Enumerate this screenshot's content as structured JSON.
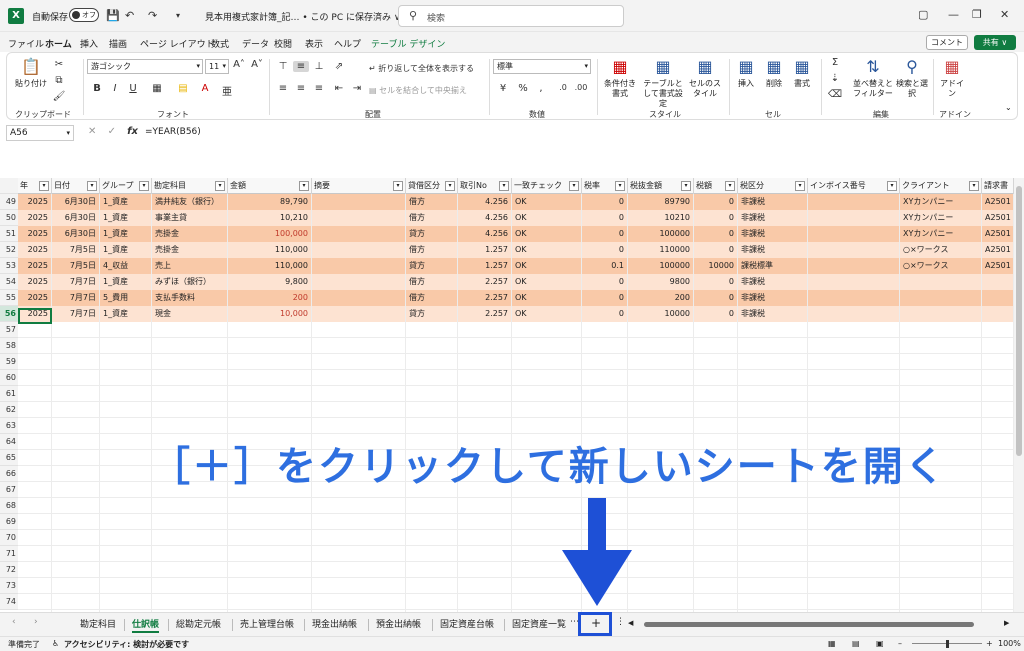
{
  "titlebar": {
    "app_icon": "excel-icon",
    "autosave_label": "自動保存",
    "autosave_state": "オフ",
    "doc_title": "見本用複式家計簿_記… • この PC に保存済み ∨",
    "search_placeholder": "検索"
  },
  "menu": {
    "tabs": [
      "ファイル",
      "ホーム",
      "挿入",
      "描画",
      "ページ レイアウト",
      "数式",
      "データ",
      "校閲",
      "表示",
      "ヘルプ",
      "テーブル デザイン"
    ],
    "comment": "コメント",
    "share": "共有 ∨"
  },
  "ribbon": {
    "paste": "貼り付け",
    "clipboard": "クリップボード",
    "font_name": "游ゴシック",
    "font_size": "11",
    "font_group": "フォント",
    "wrap_text": "折り返して全体を表示する",
    "merge_center": "セルを結合して中央揃え",
    "align_group": "配置",
    "number_format": "標準",
    "number_group": "数値",
    "cond_format": "条件付き書式",
    "table_format": "テーブルとして書式設定",
    "cell_style": "セルのスタイル",
    "style_group": "スタイル",
    "insert": "挿入",
    "delete": "削除",
    "format": "書式",
    "cells_group": "セル",
    "sort_filter": "並べ替えとフィルター",
    "find_select": "検索と選択",
    "edit_group": "編集",
    "addin": "アドイン",
    "addin_group": "アドイン"
  },
  "formula_bar": {
    "name_box": "A56",
    "formula": "=YEAR(B56)"
  },
  "columns": [
    "年",
    "日付",
    "グループ",
    "勘定科目",
    "金額",
    "摘要",
    "貸借区分",
    "取引No",
    "一致チェック",
    "税率",
    "税抜金額",
    "税額",
    "税区分",
    "インボイス番号",
    "クライアント",
    "請求書"
  ],
  "rows": [
    {
      "num": "49",
      "cells": [
        "2025",
        "6月30日",
        "1_資産",
        "満井純友（銀行）",
        "89,790",
        "",
        "借方",
        "4.256",
        "OK",
        "0",
        "89790",
        "0",
        "非課税",
        "",
        "XYカンパニー",
        "A2501"
      ],
      "red": false
    },
    {
      "num": "50",
      "cells": [
        "2025",
        "6月30日",
        "1_資産",
        "事業主貸",
        "10,210",
        "",
        "借方",
        "4.256",
        "OK",
        "0",
        "10210",
        "0",
        "非課税",
        "",
        "XYカンパニー",
        "A2501"
      ],
      "red": false
    },
    {
      "num": "51",
      "cells": [
        "2025",
        "6月30日",
        "1_資産",
        "売掛金",
        "100,000",
        "",
        "貸方",
        "4.256",
        "OK",
        "0",
        "100000",
        "0",
        "非課税",
        "",
        "XYカンパニー",
        "A2501"
      ],
      "red": true
    },
    {
      "num": "52",
      "cells": [
        "2025",
        "7月5日",
        "1_資産",
        "売掛金",
        "110,000",
        "",
        "借方",
        "1.257",
        "OK",
        "0",
        "110000",
        "0",
        "非課税",
        "",
        "○×ワークス",
        "A2501"
      ],
      "red": false
    },
    {
      "num": "53",
      "cells": [
        "2025",
        "7月5日",
        "4_収益",
        "売上",
        "110,000",
        "",
        "貸方",
        "1.257",
        "OK",
        "0.1",
        "100000",
        "10000",
        "課税標準",
        "",
        "○×ワークス",
        "A2501"
      ],
      "red": false
    },
    {
      "num": "54",
      "cells": [
        "2025",
        "7月7日",
        "1_資産",
        "みずほ（銀行）",
        "9,800",
        "",
        "借方",
        "2.257",
        "OK",
        "0",
        "9800",
        "0",
        "非課税",
        "",
        "",
        ""
      ],
      "red": false
    },
    {
      "num": "55",
      "cells": [
        "2025",
        "7月7日",
        "5_費用",
        "支払手数料",
        "200",
        "",
        "借方",
        "2.257",
        "OK",
        "0",
        "200",
        "0",
        "非課税",
        "",
        "",
        ""
      ],
      "red": true
    },
    {
      "num": "56",
      "cells": [
        "2025",
        "7月7日",
        "1_資産",
        "現金",
        "10,000",
        "",
        "貸方",
        "2.257",
        "OK",
        "0",
        "10000",
        "0",
        "非課税",
        "",
        "",
        ""
      ],
      "red": true
    }
  ],
  "empty_rows": [
    "57",
    "58",
    "59",
    "60",
    "61",
    "62",
    "63",
    "64",
    "65",
    "66",
    "67",
    "68",
    "69",
    "70",
    "71",
    "72",
    "73",
    "74"
  ],
  "annotation": "［＋］をクリックして新しいシートを開く",
  "sheet_tabs": [
    "勘定科目",
    "仕訳帳",
    "総勘定元帳",
    "売上管理台帳",
    "現金出納帳",
    "預金出納帳",
    "固定資産台帳",
    "固定資産一覧"
  ],
  "active_sheet": "仕訳帳",
  "add_sheet": "+",
  "status": {
    "ready": "準備完了",
    "accessibility": "アクセシビリティ: 検討が必要です",
    "zoom": "100%"
  },
  "colors": {
    "excel_green": "#107c41",
    "row_band_dark": "#f9c9a8",
    "row_band_light": "#fde3d2",
    "annotation_blue": "#2e6fe0",
    "arrow_blue": "#1e50d6"
  }
}
